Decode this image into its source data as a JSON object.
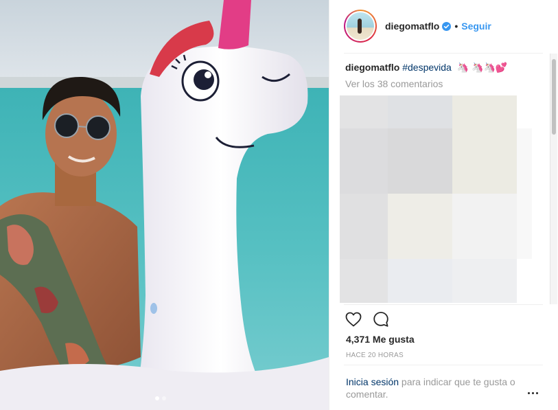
{
  "post": {
    "username": "diegomatflo",
    "separator": "•",
    "follow_label": "Seguir",
    "caption": {
      "username": "diegomatflo",
      "hashtag": "#despevida",
      "emojis": "🦄 🦄🦄💕"
    },
    "view_comments": "Ver los 38 comentarios",
    "likes": "4,371 Me gusta",
    "timestamp": "HACE 20 HORAS",
    "login_link": "Inicia sesión",
    "login_text": " para indicar que te gusta o comentar."
  },
  "colors": {
    "accent": "#3897f0",
    "link": "#003569",
    "muted": "#999999",
    "text": "#262626"
  },
  "icons": {
    "verified": "verified-badge-icon",
    "like": "heart-icon",
    "comment": "comment-bubble-icon",
    "more": "more-options-icon"
  }
}
